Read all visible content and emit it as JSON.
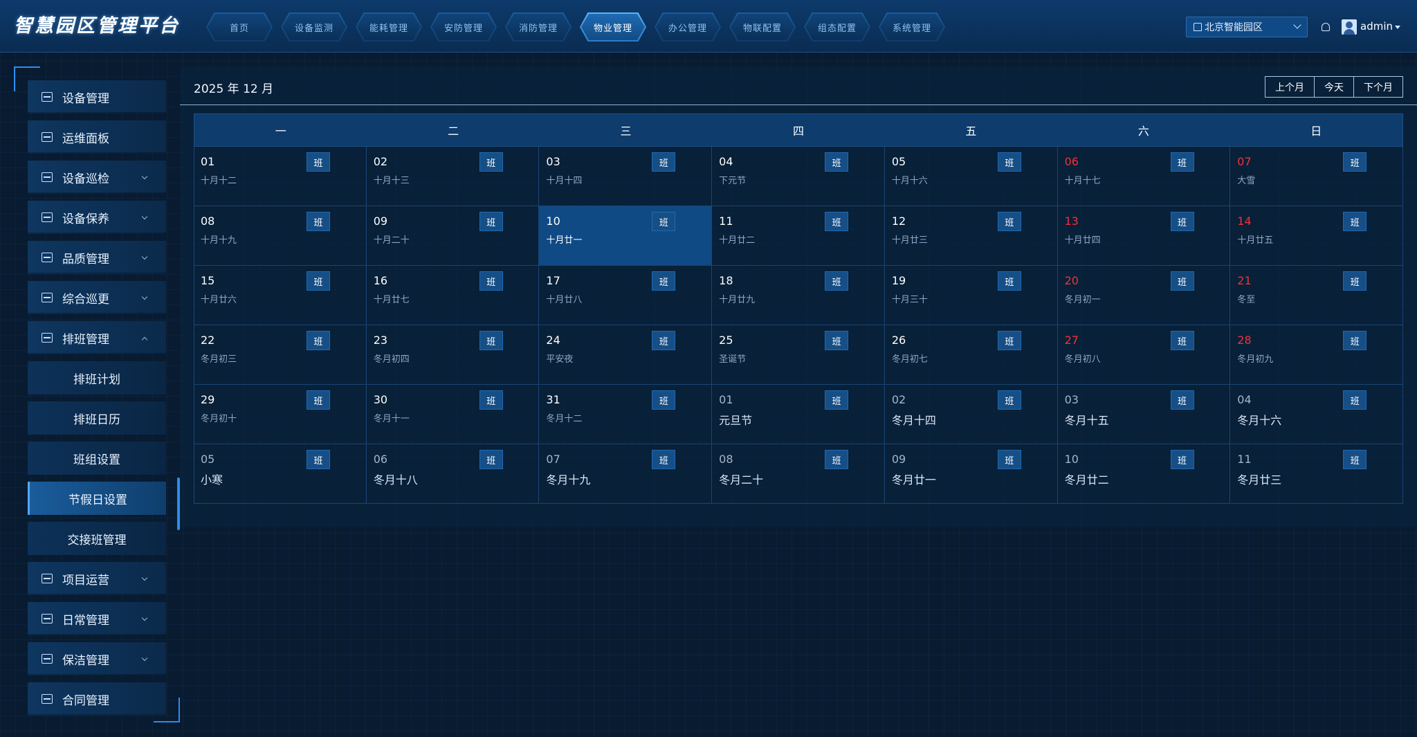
{
  "header": {
    "brand": "智慧园区管理平台",
    "nav": [
      "首页",
      "设备监测",
      "能耗管理",
      "安防管理",
      "消防管理",
      "物业管理",
      "办公管理",
      "物联配置",
      "组态配置",
      "系统管理"
    ],
    "active_nav_index": 5,
    "park": "北京智能园区",
    "user": "admin"
  },
  "sidebar": {
    "items": [
      {
        "label": "设备管理",
        "icon": "device-icon",
        "expandable": false
      },
      {
        "label": "运维面板",
        "icon": "dashboard-icon",
        "expandable": false
      },
      {
        "label": "设备巡检",
        "icon": "inspect-icon",
        "expandable": true
      },
      {
        "label": "设备保养",
        "icon": "maintain-icon",
        "expandable": true
      },
      {
        "label": "品质管理",
        "icon": "quality-icon",
        "expandable": true
      },
      {
        "label": "综合巡更",
        "icon": "patrol-icon",
        "expandable": true
      },
      {
        "label": "排班管理",
        "icon": "calendar-icon",
        "expandable": true,
        "expanded": true
      },
      {
        "label": "项目运营",
        "icon": "chart-icon",
        "expandable": true
      },
      {
        "label": "日常管理",
        "icon": "daily-icon",
        "expandable": true
      },
      {
        "label": "保洁管理",
        "icon": "clean-icon",
        "expandable": true
      },
      {
        "label": "合同管理",
        "icon": "contract-icon",
        "expandable": false
      }
    ],
    "submenu": [
      "排班计划",
      "排班日历",
      "班组设置",
      "节假日设置",
      "交接班管理"
    ],
    "active_sub": "节假日设置"
  },
  "calendar": {
    "title": "2025 年 12 月",
    "buttons": [
      "上个月",
      "今天",
      "下个月"
    ],
    "weekdays": [
      "一",
      "二",
      "三",
      "四",
      "五",
      "六",
      "日"
    ],
    "shift_label": "班",
    "days": [
      {
        "d": "01",
        "l": "十月十二"
      },
      {
        "d": "02",
        "l": "十月十三"
      },
      {
        "d": "03",
        "l": "十月十四"
      },
      {
        "d": "04",
        "l": "下元节"
      },
      {
        "d": "05",
        "l": "十月十六"
      },
      {
        "d": "06",
        "l": "十月十七",
        "w": true
      },
      {
        "d": "07",
        "l": "大雪",
        "w": true
      },
      {
        "d": "08",
        "l": "十月十九"
      },
      {
        "d": "09",
        "l": "十月二十"
      },
      {
        "d": "10",
        "l": "十月廿一",
        "t": true
      },
      {
        "d": "11",
        "l": "十月廿二"
      },
      {
        "d": "12",
        "l": "十月廿三"
      },
      {
        "d": "13",
        "l": "十月廿四",
        "w": true
      },
      {
        "d": "14",
        "l": "十月廿五",
        "w": true
      },
      {
        "d": "15",
        "l": "十月廿六"
      },
      {
        "d": "16",
        "l": "十月廿七"
      },
      {
        "d": "17",
        "l": "十月廿八"
      },
      {
        "d": "18",
        "l": "十月廿九"
      },
      {
        "d": "19",
        "l": "十月三十"
      },
      {
        "d": "20",
        "l": "冬月初一",
        "w": true
      },
      {
        "d": "21",
        "l": "冬至",
        "w": true
      },
      {
        "d": "22",
        "l": "冬月初三"
      },
      {
        "d": "23",
        "l": "冬月初四"
      },
      {
        "d": "24",
        "l": "平安夜"
      },
      {
        "d": "25",
        "l": "圣诞节"
      },
      {
        "d": "26",
        "l": "冬月初七"
      },
      {
        "d": "27",
        "l": "冬月初八",
        "w": true
      },
      {
        "d": "28",
        "l": "冬月初九",
        "w": true
      },
      {
        "d": "29",
        "l": "冬月初十"
      },
      {
        "d": "30",
        "l": "冬月十一"
      },
      {
        "d": "31",
        "l": "冬月十二"
      },
      {
        "d": "01",
        "l": "元旦节",
        "o": true
      },
      {
        "d": "02",
        "l": "冬月十四",
        "o": true
      },
      {
        "d": "03",
        "l": "冬月十五",
        "o": true
      },
      {
        "d": "04",
        "l": "冬月十六",
        "o": true
      },
      {
        "d": "05",
        "l": "小寒",
        "o": true
      },
      {
        "d": "06",
        "l": "冬月十八",
        "o": true
      },
      {
        "d": "07",
        "l": "冬月十九",
        "o": true
      },
      {
        "d": "08",
        "l": "冬月二十",
        "o": true
      },
      {
        "d": "09",
        "l": "冬月廿一",
        "o": true
      },
      {
        "d": "10",
        "l": "冬月廿二",
        "o": true
      },
      {
        "d": "11",
        "l": "冬月廿三",
        "o": true
      }
    ]
  }
}
